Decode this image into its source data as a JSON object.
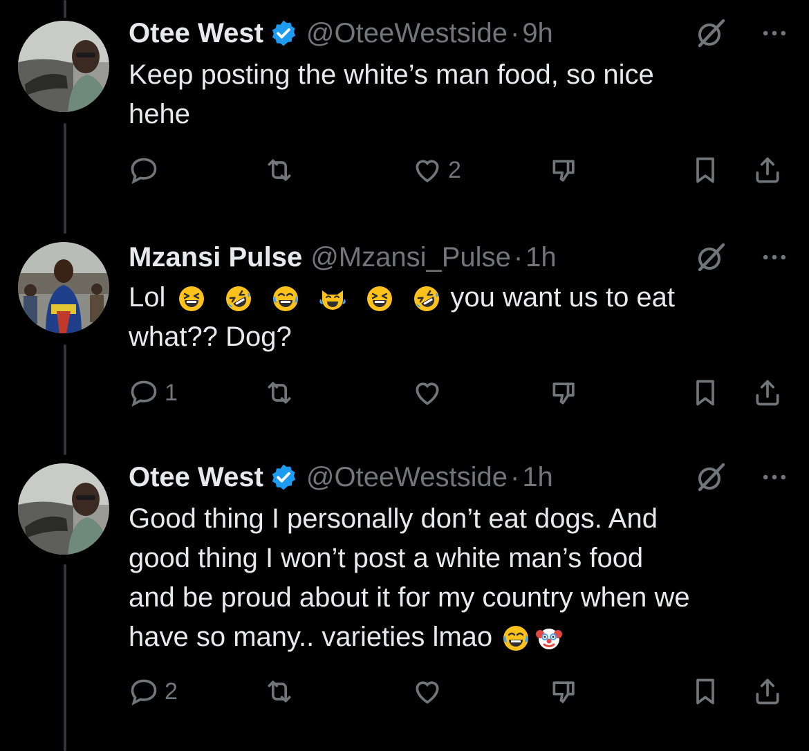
{
  "tweets": [
    {
      "name": "Otee West",
      "verified": true,
      "handle": "@OteeWestside",
      "sep": "·",
      "time": "9h",
      "text_lines": [
        "Keep posting the white’s man food, so nice",
        "hehe"
      ],
      "actions": {
        "reply": "",
        "retweet": "",
        "like": "2",
        "dislike": ""
      },
      "avatar": "avatar-driving"
    },
    {
      "name": "Mzansi Pulse",
      "verified": false,
      "handle": "@Mzansi_Pulse",
      "sep": "·",
      "time": "1h",
      "text_prefix": "Lol",
      "emojis": [
        "grinning-squinting-face",
        "rolling-on-floor-laughing",
        "tears-of-joy",
        "cat-tears-of-joy",
        "grinning-squinting-face",
        "rolling-on-floor-laughing"
      ],
      "text_suffix": "you want us to eat",
      "text_line2": "what?? Dog?",
      "actions": {
        "reply": "1",
        "retweet": "",
        "like": "",
        "dislike": ""
      },
      "avatar": "avatar-man-crowd"
    },
    {
      "name": "Otee West",
      "verified": true,
      "handle": "@OteeWestside",
      "sep": "·",
      "time": "1h",
      "text_lines": [
        "Good thing I personally don’t eat dogs. And",
        "good thing I won’t post a white man’s food",
        "and be proud about it for my country when we",
        "have so many.. varieties lmao"
      ],
      "trailing_emojis": [
        "tears-of-joy",
        "clown-face"
      ],
      "actions": {
        "reply": "2",
        "retweet": "",
        "like": "",
        "dislike": ""
      },
      "avatar": "avatar-driving"
    }
  ],
  "colors": {
    "background": "#000000",
    "text": "#e7e9ea",
    "muted": "#71767b",
    "verified": "#1d9bf0",
    "line": "#333639"
  }
}
